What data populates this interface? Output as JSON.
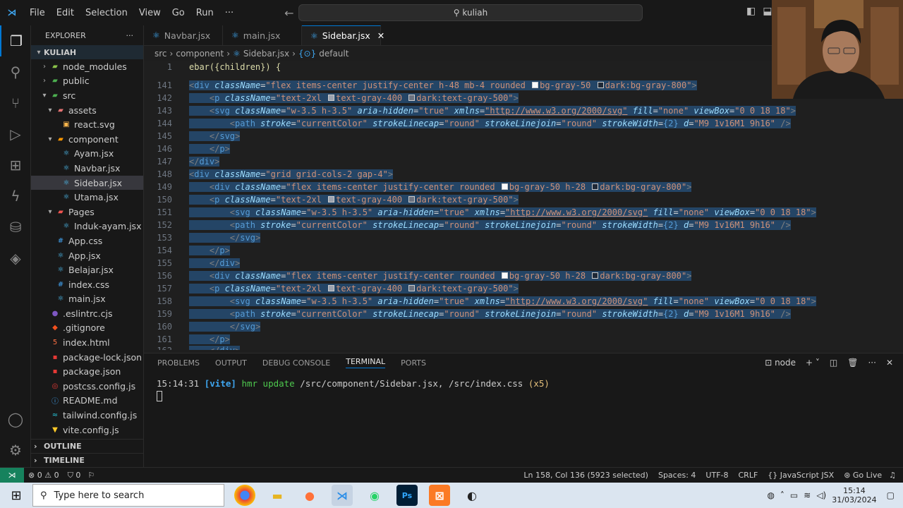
{
  "titlebar": {
    "menu": [
      "File",
      "Edit",
      "Selection",
      "View",
      "Go",
      "Run",
      "···"
    ],
    "search": "kuliah"
  },
  "sidebar": {
    "title": "EXPLORER",
    "more": "···",
    "root": "KULIAH",
    "items": [
      {
        "label": "node_modules",
        "depth": 1,
        "type": "folder",
        "open": false,
        "color": "#8bc34a",
        "glyph": "▰"
      },
      {
        "label": "public",
        "depth": 1,
        "type": "folder",
        "open": false,
        "color": "#4caf50",
        "glyph": "▰"
      },
      {
        "label": "src",
        "depth": 1,
        "type": "folder",
        "open": true,
        "color": "#4caf50",
        "glyph": "▰"
      },
      {
        "label": "assets",
        "depth": 2,
        "type": "folder",
        "open": true,
        "color": "#e57373",
        "glyph": "▰"
      },
      {
        "label": "react.svg",
        "depth": 3,
        "type": "file",
        "color": "#ffb74d",
        "glyph": "▣"
      },
      {
        "label": "component",
        "depth": 2,
        "type": "folder",
        "open": true,
        "color": "#ff9800",
        "glyph": "▰"
      },
      {
        "label": "Ayam.jsx",
        "depth": 3,
        "type": "file",
        "color": "#4fc3f7",
        "glyph": "⚛"
      },
      {
        "label": "Navbar.jsx",
        "depth": 3,
        "type": "file",
        "color": "#4fc3f7",
        "glyph": "⚛"
      },
      {
        "label": "Sidebar.jsx",
        "depth": 3,
        "type": "file",
        "color": "#4fc3f7",
        "glyph": "⚛",
        "selected": true
      },
      {
        "label": "Utama.jsx",
        "depth": 3,
        "type": "file",
        "color": "#4fc3f7",
        "glyph": "⚛"
      },
      {
        "label": "Pages",
        "depth": 2,
        "type": "folder",
        "open": true,
        "color": "#ef5350",
        "glyph": "▰"
      },
      {
        "label": "Induk-ayam.jsx",
        "depth": 3,
        "type": "file",
        "color": "#4fc3f7",
        "glyph": "⚛"
      },
      {
        "label": "App.css",
        "depth": 2,
        "type": "file",
        "color": "#42a5f5",
        "glyph": "#"
      },
      {
        "label": "App.jsx",
        "depth": 2,
        "type": "file",
        "color": "#4fc3f7",
        "glyph": "⚛"
      },
      {
        "label": "Belajar.jsx",
        "depth": 2,
        "type": "file",
        "color": "#4fc3f7",
        "glyph": "⚛"
      },
      {
        "label": "index.css",
        "depth": 2,
        "type": "file",
        "color": "#42a5f5",
        "glyph": "#"
      },
      {
        "label": "main.jsx",
        "depth": 2,
        "type": "file",
        "color": "#4fc3f7",
        "glyph": "⚛"
      },
      {
        "label": ".eslintrc.cjs",
        "depth": 1,
        "type": "file",
        "color": "#7e57c2",
        "glyph": "●"
      },
      {
        "label": ".gitignore",
        "depth": 1,
        "type": "file",
        "color": "#f4511e",
        "glyph": "◆"
      },
      {
        "label": "index.html",
        "depth": 1,
        "type": "file",
        "color": "#ff7043",
        "glyph": "5"
      },
      {
        "label": "package-lock.json",
        "depth": 1,
        "type": "file",
        "color": "#e53935",
        "glyph": "▪"
      },
      {
        "label": "package.json",
        "depth": 1,
        "type": "file",
        "color": "#e53935",
        "glyph": "▪"
      },
      {
        "label": "postcss.config.js",
        "depth": 1,
        "type": "file",
        "color": "#e53935",
        "glyph": "◎"
      },
      {
        "label": "README.md",
        "depth": 1,
        "type": "file",
        "color": "#42a5f5",
        "glyph": "ⓘ"
      },
      {
        "label": "tailwind.config.js",
        "depth": 1,
        "type": "file",
        "color": "#26c6da",
        "glyph": "≈"
      },
      {
        "label": "vite.config.js",
        "depth": 1,
        "type": "file",
        "color": "#ffca28",
        "glyph": "▼"
      }
    ],
    "outline": "OUTLINE",
    "timeline": "TIMELINE"
  },
  "tabs": [
    {
      "label": "Navbar.jsx"
    },
    {
      "label": "main.jsx"
    },
    {
      "label": "Sidebar.jsx",
      "active": true
    }
  ],
  "breadcrumb": [
    "src",
    "component",
    "Sidebar.jsx",
    "default"
  ],
  "editor": {
    "top_text": "ebar({children}) {",
    "lines": [
      {
        "n": "1",
        "sel": false
      },
      {
        "n": "141"
      },
      {
        "n": "142"
      },
      {
        "n": "143"
      },
      {
        "n": "144"
      },
      {
        "n": "145"
      },
      {
        "n": "146"
      },
      {
        "n": "147"
      },
      {
        "n": "148"
      },
      {
        "n": "149"
      },
      {
        "n": "150"
      },
      {
        "n": "151"
      },
      {
        "n": "152"
      },
      {
        "n": "153"
      },
      {
        "n": "154"
      },
      {
        "n": "155"
      },
      {
        "n": "156"
      },
      {
        "n": "157"
      },
      {
        "n": "158"
      },
      {
        "n": "159"
      },
      {
        "n": "160"
      },
      {
        "n": "161"
      },
      {
        "n": "162"
      }
    ]
  },
  "panel": {
    "tabs": [
      "PROBLEMS",
      "OUTPUT",
      "DEBUG CONSOLE",
      "TERMINAL",
      "PORTS"
    ],
    "active": "TERMINAL",
    "shell": "node",
    "time": "15:14:31",
    "vite": "[vite]",
    "hmr": "hmr update",
    "files": "/src/component/Sidebar.jsx, /src/index.css",
    "count": "(x5)"
  },
  "status": {
    "errors": "0",
    "warnings": "0",
    "ports": "0",
    "position": "Ln 158, Col 136 (5923 selected)",
    "spaces": "Spaces: 4",
    "encoding": "UTF-8",
    "eol": "CRLF",
    "language": "JavaScript JSX",
    "live": "Go Live"
  },
  "taskbar": {
    "search": "Type here to search",
    "time": "15:14",
    "date": "31/03/2024"
  }
}
